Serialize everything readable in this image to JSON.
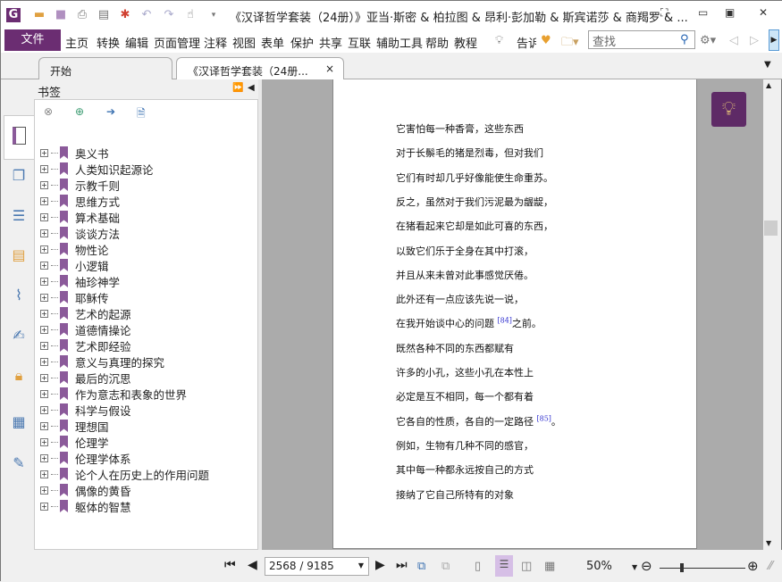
{
  "titlebar": {
    "title": "《汉译哲学套装（24册）》亚当·斯密 & 柏拉图 & 昂利·彭加勒 & 斯宾诺莎 & 商羯罗 & ..."
  },
  "menubar": {
    "file": "文件",
    "items": [
      "主页",
      "转换",
      "编辑",
      "页面管理",
      "注释",
      "视图",
      "表单",
      "保护",
      "共享",
      "互联",
      "辅助工具",
      "帮助",
      "教程"
    ],
    "tell": "告诉",
    "search_placeholder": "查找"
  },
  "tabs": [
    {
      "label": "开始"
    },
    {
      "label": "《汉译哲学套装（24册..."
    }
  ],
  "bookmarks": {
    "title": "书签",
    "items": [
      "奥义书",
      "人类知识起源论",
      "示教千则",
      "思维方式",
      "算术基础",
      "谈谈方法",
      "物性论",
      "小逻辑",
      "袖珍神学",
      "耶稣传",
      "艺术的起源",
      "道德情操论",
      "艺术即经验",
      "意义与真理的探究",
      "最后的沉思",
      "作为意志和表象的世界",
      "科学与假设",
      "理想国",
      "伦理学",
      "伦理学体系",
      "论个人在历史上的作用问题",
      "偶像的黄昏",
      "躯体的智慧"
    ]
  },
  "page": {
    "lines": [
      {
        "text": "它害怕每一种香膏，这些东西"
      },
      {
        "text": "对于长鬃毛的猪是烈毒，但对我们"
      },
      {
        "text": "它们有时却几乎好像能使生命重苏。"
      },
      {
        "text": "反之，虽然对于我们污泥最为龌龊，"
      },
      {
        "text": "在猪看起来它却是如此可喜的东西，"
      },
      {
        "text": "以致它们乐于全身在其中打滚，"
      },
      {
        "text": "并且从来未曾对此事感觉厌倦。"
      },
      {
        "text": "此外还有一点应该先说一说，"
      },
      {
        "text": "在我开始谈中心的问题",
        "note": "[84]",
        "after": "之前。"
      },
      {
        "text": "既然各种不同的东西都赋有"
      },
      {
        "text": "许多的小孔，这些小孔在本性上"
      },
      {
        "text": "必定是互不相同，每一个都有着"
      },
      {
        "text": "它各自的性质，各自的一定路径",
        "note": "[85]",
        "after": "。"
      },
      {
        "text": "例如，生物有几种不同的感官，"
      },
      {
        "text": "其中每一种都永远按自己的方式"
      },
      {
        "text": "接纳了它自己所特有的对象"
      }
    ]
  },
  "status": {
    "page": "2568 / 9185",
    "zoom": "50%"
  },
  "colors": {
    "accent": "#6b2d72"
  }
}
